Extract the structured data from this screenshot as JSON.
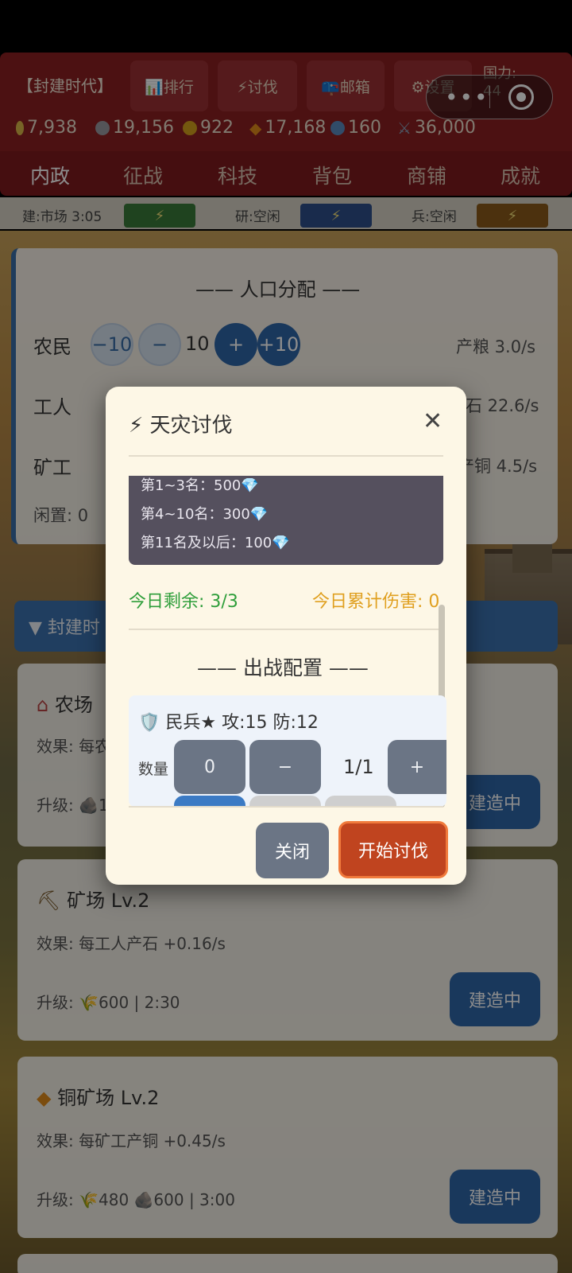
{
  "header": {
    "era": "【封建时代】",
    "buttons": [
      {
        "icon": "chart-icon",
        "label": "📊排行"
      },
      {
        "icon": "lightning-icon",
        "label": "⚡讨伐"
      },
      {
        "icon": "mailbox-icon",
        "label": "📪邮箱"
      },
      {
        "icon": "gear-icon",
        "label": "⚙设置"
      }
    ],
    "power_label": "国力:",
    "power_value": "44"
  },
  "resources": [
    {
      "icon": "grain-icon",
      "value": "7,938",
      "color": "#d9b648"
    },
    {
      "icon": "stone-icon",
      "value": "19,156",
      "color": "#9a9aa0"
    },
    {
      "icon": "copper-coin-icon",
      "value": "922",
      "color": "#d4a11c"
    },
    {
      "icon": "diamond-icon",
      "value": "17,168",
      "color": "#e08a1a"
    },
    {
      "icon": "population-icon",
      "value": "160",
      "color": "#5a8ac0"
    },
    {
      "icon": "swords-icon",
      "value": "36,000",
      "color": "#8aa0b8"
    }
  ],
  "nav": [
    "内政",
    "征战",
    "科技",
    "背包",
    "商铺",
    "成就"
  ],
  "status": {
    "build": "建:市场 3:05",
    "research": "研:空闲",
    "soldier": "兵:空闲",
    "bolt": "⚡"
  },
  "population": {
    "title": "—— 人口分配 ——",
    "rows": [
      {
        "label": "农民",
        "value": "10",
        "rate": "产粮 3.0/s"
      },
      {
        "label": "工人",
        "value": "",
        "rate": "石 22.6/s"
      },
      {
        "label": "矿工",
        "value": "",
        "rate": "产铜 4.5/s"
      }
    ],
    "idle": "闲置: 0",
    "buttons": {
      "minus10": "−10",
      "minus": "−",
      "plus": "+",
      "plus10": "+10"
    }
  },
  "era_section": "▼ 封建时",
  "buildings": [
    {
      "icon": "house-icon",
      "name": "农场",
      "effect": "效果: 每农",
      "upgrade": "升级: 🪨1",
      "button": "建造中"
    },
    {
      "icon": "pickaxe-icon",
      "name": "矿场 Lv.2",
      "effect": "效果: 每工人产石 +0.16/s",
      "upgrade": "升级: 🌾600 | 2:30",
      "button": "建造中"
    },
    {
      "icon": "diamond-icon",
      "name": "铜矿场 Lv.2",
      "effect": "效果: 每矿工产铜 +0.45/s",
      "upgrade": "升级: 🌾480 🪨600 | 3:00",
      "button": "建造中"
    }
  ],
  "modal": {
    "title": "⚡ 天灾讨伐",
    "close_symbol": "✕",
    "rewards": [
      "第1~3名：500💎",
      "第4~10名：300💎",
      "第11名及以后：100💎"
    ],
    "remaining": "今日剩余: 3/3",
    "damage": "今日累计伤害: 0",
    "config_title": "—— 出战配置 ——",
    "unit": {
      "name": "🛡️ 民兵★  攻:15 防:12",
      "qty_label": "数量",
      "zero": "0",
      "minus": "−",
      "count": "1/1",
      "plus": "+"
    },
    "close_btn": "关闭",
    "start_btn": "开始讨伐"
  },
  "capsule": {
    "dots": "•••"
  }
}
